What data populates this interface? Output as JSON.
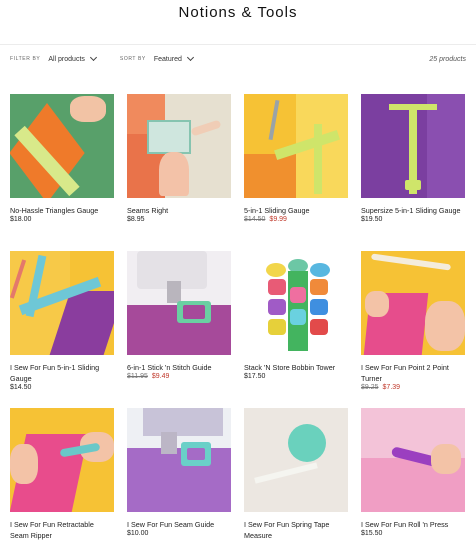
{
  "page": {
    "title": "Notions & Tools"
  },
  "filters": {
    "filter_label": "Filter by",
    "filter_value": "All products",
    "sort_label": "Sort by",
    "sort_value": "Featured",
    "count": "25 products"
  },
  "products": [
    {
      "name": "No-Hassle Triangles Gauge",
      "price": "$18.00",
      "was": "",
      "sale": ""
    },
    {
      "name": "Seams Right",
      "price": "$8.95",
      "was": "",
      "sale": ""
    },
    {
      "name": "5-in-1 Sliding Gauge",
      "price": "",
      "was": "$14.50",
      "sale": "$9.99"
    },
    {
      "name": "Supersize 5-in-1 Sliding Gauge",
      "price": "$19.50",
      "was": "",
      "sale": ""
    },
    {
      "name": "I Sew For Fun 5-in-1 Sliding Gauge",
      "price": "$14.50",
      "was": "",
      "sale": ""
    },
    {
      "name": "6-in-1 Stick 'n Stitch Guide",
      "price": "",
      "was": "$11.95",
      "sale": "$9.49"
    },
    {
      "name": "Stack 'N Store Bobbin Tower",
      "price": "$17.50",
      "was": "",
      "sale": ""
    },
    {
      "name": "I Sew For Fun Point 2 Point Turner",
      "price": "",
      "was": "$9.25",
      "sale": "$7.39"
    },
    {
      "name": "I Sew For Fun Retractable Seam Ripper",
      "price": "",
      "was": "",
      "sale": ""
    },
    {
      "name": "I Sew For Fun Seam Guide",
      "price": "$10.00",
      "was": "",
      "sale": ""
    },
    {
      "name": "I Sew For Fun Spring Tape Measure",
      "price": "",
      "was": "",
      "sale": ""
    },
    {
      "name": "I Sew For Fun Roll 'n Press",
      "price": "$15.50",
      "was": "",
      "sale": ""
    }
  ],
  "colors": {
    "sale": "#c0392b",
    "text": "#222222"
  }
}
